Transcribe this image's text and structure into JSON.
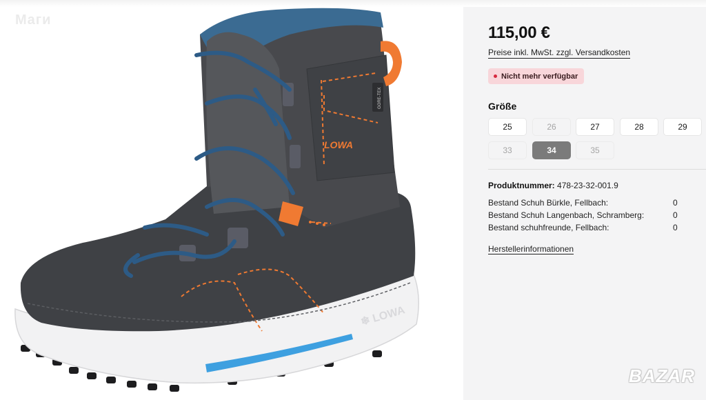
{
  "watermark": {
    "top_left": "Mаги",
    "bottom_right": "BAZAR"
  },
  "product": {
    "image_alt": "LOWA Kinder Winterstiefel",
    "price": "115,00 €",
    "price_note": "Preise inkl. MwSt. zzgl. Versandkosten",
    "availability_badge": "Nicht mehr verfügbar",
    "size_heading": "Größe",
    "sizes": [
      {
        "label": "25",
        "state": "available"
      },
      {
        "label": "26",
        "state": "disabled"
      },
      {
        "label": "27",
        "state": "available"
      },
      {
        "label": "28",
        "state": "available"
      },
      {
        "label": "29",
        "state": "available"
      },
      {
        "label": "33",
        "state": "disabled"
      },
      {
        "label": "34",
        "state": "selected"
      },
      {
        "label": "35",
        "state": "disabled"
      }
    ],
    "product_number_label": "Produktnummer:",
    "product_number_value": "478-23-32-001.9",
    "stock": [
      {
        "store": "Bestand Schuh Bürkle, Fellbach:",
        "qty": "0"
      },
      {
        "store": "Bestand Schuh Langenbach, Schramberg:",
        "qty": "0"
      },
      {
        "store": "Bestand schuhfreunde, Fellbach:",
        "qty": "0"
      }
    ],
    "manufacturer_link": "Herstellerinformationen"
  },
  "boot_graphic": {
    "brand_text": "LOWA",
    "gtx_text": "GORE-TEX",
    "colors": {
      "upper": "#45474b",
      "suede": "#3f4145",
      "lace": "#2d5b86",
      "accent": "#f07a32",
      "sole": "#f2f2f3",
      "sole_stripe": "#3ea0e0"
    }
  },
  "colors": {
    "badge_bg": "#f8d6da",
    "badge_dot": "#d6293e",
    "selected_size": "#7b7b7b"
  }
}
